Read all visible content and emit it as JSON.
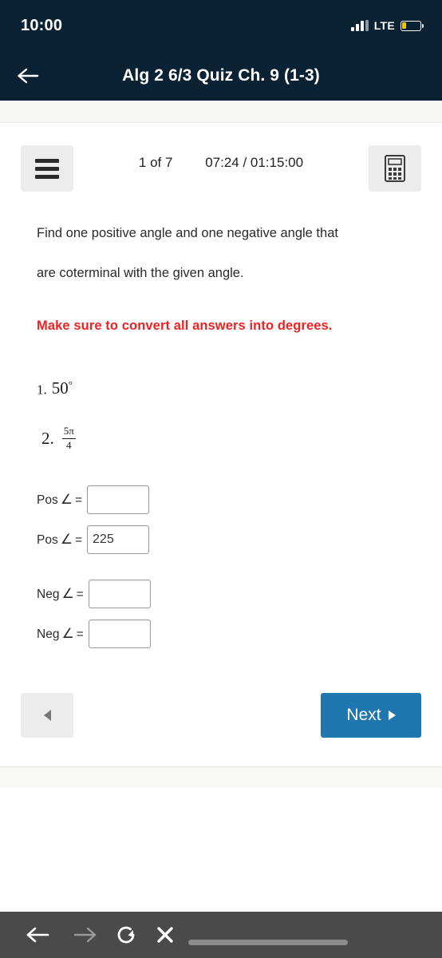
{
  "status_bar": {
    "time": "10:00",
    "network_label": "LTE",
    "signal_icon": "cellular-signal-icon",
    "battery_icon": "battery-low-icon",
    "battery_color": "#f2c100"
  },
  "app_bar": {
    "back_icon": "back-arrow-icon",
    "title": "Alg 2 6/3 Quiz Ch. 9 (1-3)",
    "background_color": "#0b2234"
  },
  "quiz_toolbar": {
    "menu_icon": "hamburger-menu-icon",
    "page_indicator": "1 of 7",
    "timer": "07:24 / 01:15:00",
    "calculator_icon": "calculator-icon"
  },
  "question": {
    "line1": "Find one positive angle and one negative angle that",
    "line2": "are coterminal with the given angle.",
    "warning": "Make sure to convert all answers into degrees.",
    "warning_color": "#ee2222",
    "items": [
      {
        "number": "1.",
        "value": "50",
        "degree": "°"
      },
      {
        "number": "2.",
        "numerator": "5π",
        "denominator": "4"
      }
    ]
  },
  "answers": {
    "angle_symbol": "∠",
    "equals": "=",
    "rows": [
      {
        "label": "Pos",
        "value": ""
      },
      {
        "label": "Pos",
        "value": "225"
      },
      {
        "label": "Neg",
        "value": ""
      },
      {
        "label": "Neg",
        "value": ""
      }
    ]
  },
  "navigation": {
    "prev_icon": "previous-triangle-icon",
    "prev_label": "",
    "next_label": "Next",
    "next_icon": "next-triangle-icon",
    "next_color": "#2077b0"
  },
  "browser_bar": {
    "background_color": "#4a4a4a",
    "back_icon": "browser-back-arrow-icon",
    "forward_icon": "browser-forward-arrow-icon",
    "reload_icon": "browser-reload-icon",
    "stop_icon": "browser-stop-close-icon"
  }
}
